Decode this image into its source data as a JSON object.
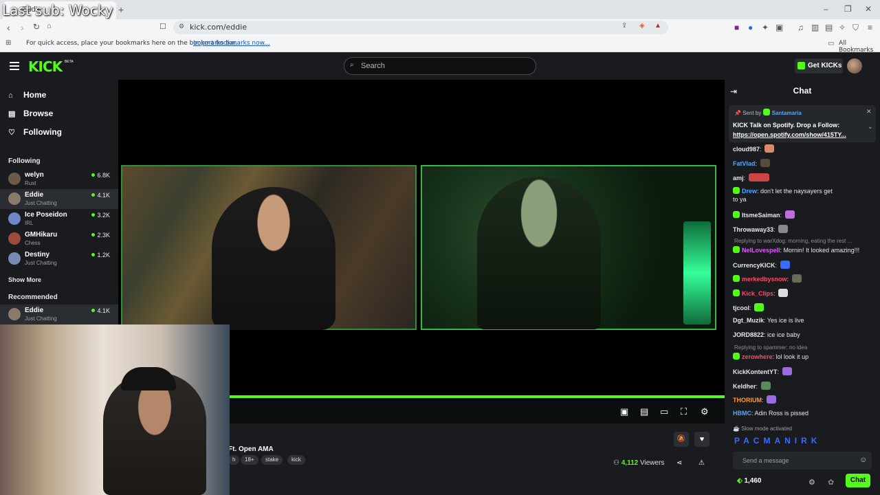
{
  "overlay": {
    "text": "Last sub: Wocky"
  },
  "browser": {
    "url": "kick.com/eddie",
    "bookmarks_hint": "For quick access, place your bookmarks here on the bookmarks bar.",
    "import_link": "Import bookmarks now...",
    "all_bookmarks": "All Bookmarks"
  },
  "header": {
    "logo": "KICK",
    "logo_sup": "BETA",
    "search_placeholder": "Search",
    "get_kicks": "Get KICKs"
  },
  "sidebar": {
    "nav": [
      {
        "label": "Home",
        "icon": "home-icon"
      },
      {
        "label": "Browse",
        "icon": "browse-icon"
      },
      {
        "label": "Following",
        "icon": "heart-icon"
      }
    ],
    "following_title": "Following",
    "following": [
      {
        "name": "welyn",
        "category": "Rust",
        "viewers": "6.8K",
        "color": "#6b5a4a"
      },
      {
        "name": "Eddie",
        "category": "Just Chatting",
        "viewers": "4.1K",
        "color": "#8a7a6a"
      },
      {
        "name": "Ice Poseidon",
        "category": "IRL",
        "viewers": "3.2K",
        "color": "#6f87c7"
      },
      {
        "name": "GMHikaru",
        "category": "Chess",
        "viewers": "2.3K",
        "color": "#a04a3a"
      },
      {
        "name": "Destiny",
        "category": "Just Chatting",
        "viewers": "1.2K",
        "color": "#7a8ab5"
      }
    ],
    "show_more": "Show More",
    "recommended_title": "Recommended",
    "recommended": [
      {
        "name": "Eddie",
        "category": "Just Chatting",
        "viewers": "4.1K",
        "color": "#8a7a6a"
      }
    ]
  },
  "stream": {
    "title_fragment": "Ft. Open AMA",
    "tag_fragment": "h",
    "tags": [
      "18+",
      "stake",
      "kick"
    ],
    "viewers_count": "4,112",
    "viewers_label": "Viewers"
  },
  "chat": {
    "title": "Chat",
    "pinned": {
      "sent_by": "Sent by",
      "user": "Santamaria",
      "text": "KICK Talk on Spotify. Drop a Follow:",
      "link": "https://open.spotify.com/show/415TY..."
    },
    "messages": [
      {
        "user": "cloud987",
        "text": "",
        "color": "#e8e8e8"
      },
      {
        "user": "FatVlad",
        "text": "",
        "color": "#53a8fc"
      },
      {
        "user": "amj",
        "text": "",
        "color": "#e8e8e8"
      },
      {
        "user": "Drew",
        "text": "don't let the naysayers get",
        "color": "#53a8fc"
      },
      {
        "user": "",
        "text": "to ya",
        "color": "#e8e8e8"
      },
      {
        "user": "ItsmeSaiman",
        "text": "",
        "color": "#e8e8e8"
      },
      {
        "user": "Throwaway33",
        "text": "",
        "color": "#e8e8e8"
      },
      {
        "user": "NelLovespell",
        "text": "Mornin! It looked amazing!!!",
        "color": "#e25cff"
      },
      {
        "user": "CurrencyKICK",
        "text": "",
        "color": "#e8e8e8"
      },
      {
        "user": "merkedbysnow",
        "text": "",
        "color": "#ff4a6b"
      },
      {
        "user": "Kick_Clips",
        "text": "",
        "color": "#ff4a6b"
      },
      {
        "user": "tjcool",
        "text": "",
        "color": "#e8e8e8"
      },
      {
        "user": "Dgt_Muzik",
        "text": "Yes ice is live",
        "color": "#e8e8e8"
      },
      {
        "user": "JORD8822",
        "text": "ice ice baby",
        "color": "#e8e8e8"
      },
      {
        "user": "zerowhere",
        "text": "lol look it up",
        "color": "#ff4a6b"
      },
      {
        "user": "KickKontentYT",
        "text": "",
        "color": "#e8e8e8"
      },
      {
        "user": "Keldher",
        "text": "",
        "color": "#e8e8e8"
      },
      {
        "user": "THORIUM",
        "text": "",
        "color": "#ff9b2f"
      },
      {
        "user": "HBMC",
        "text": "Adin Ross is pissed",
        "color": "#53a8fc"
      }
    ],
    "reply1": "Replying to warXdog: morning, eating the rest ...",
    "reply2": "Replying to spammer: no idea",
    "slow_mode": "Slow mode activated",
    "emote_strip": "PACMANIRK",
    "input_placeholder": "Send a message",
    "points": "1,460",
    "chat_button": "Chat"
  },
  "colors": {
    "accent": "#53fc18",
    "bg": "#0b0e0f",
    "panel": "#191b1f"
  }
}
